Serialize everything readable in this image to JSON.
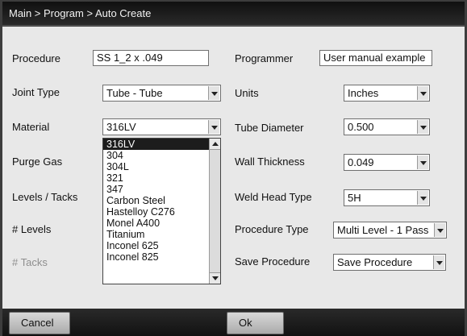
{
  "breadcrumb": "Main > Program > Auto Create",
  "left": {
    "procedure_label": "Procedure",
    "procedure_value": "SS 1_2 x .049",
    "joint_type_label": "Joint Type",
    "joint_type_value": "Tube - Tube",
    "material_label": "Material",
    "material_value": "316LV",
    "purge_gas_label": "Purge Gas",
    "levels_tacks_label": "Levels / Tacks",
    "levels_label": "# Levels",
    "tacks_label": "# Tacks"
  },
  "material_options": [
    "316LV",
    "304",
    "304L",
    "321",
    "347",
    "Carbon Steel",
    "Hastelloy C276",
    "Monel A400",
    "Titanium",
    "Inconel 625",
    "Inconel 825"
  ],
  "right": {
    "programmer_label": "Programmer",
    "programmer_value": "User manual example",
    "units_label": "Units",
    "units_value": "Inches",
    "tube_diameter_label": "Tube Diameter",
    "tube_diameter_value": "0.500",
    "wall_thickness_label": "Wall Thickness",
    "wall_thickness_value": "0.049",
    "weld_head_label": "Weld Head Type",
    "weld_head_value": "5H",
    "procedure_type_label": "Procedure Type",
    "procedure_type_value": "Multi Level - 1 Pass",
    "save_procedure_label": "Save Procedure",
    "save_procedure_value": "Save Procedure"
  },
  "buttons": {
    "cancel": "Cancel",
    "ok": "Ok"
  }
}
